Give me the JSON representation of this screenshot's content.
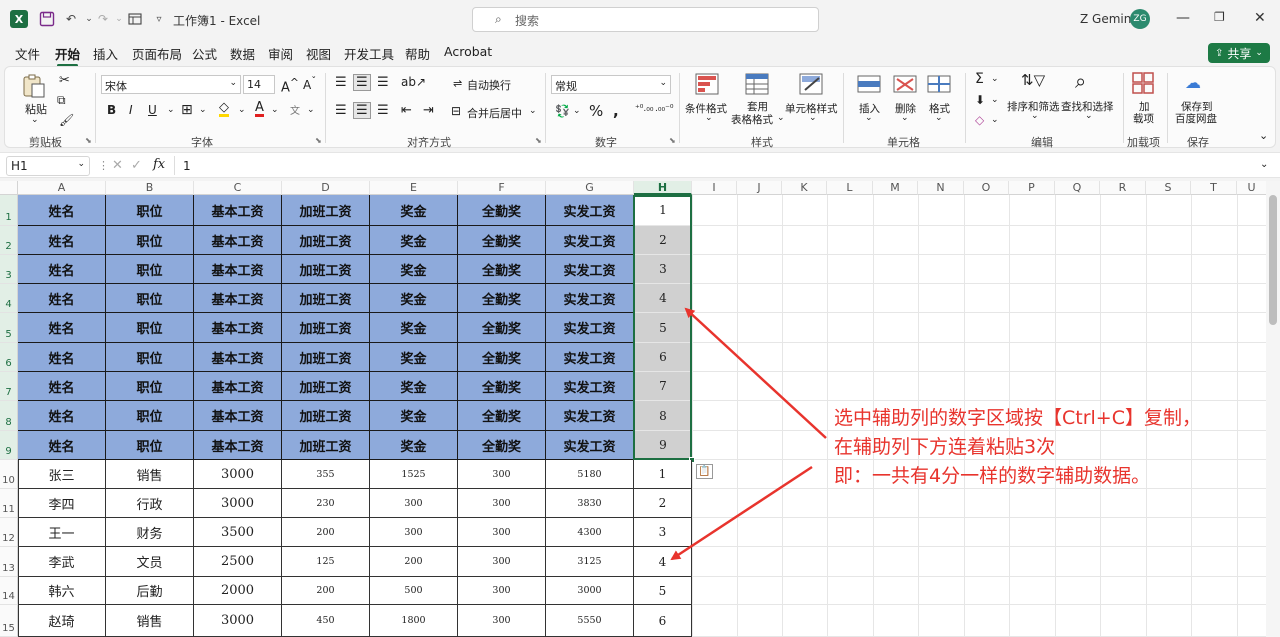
{
  "titlebar": {
    "title": "工作簿1 - Excel",
    "search_placeholder": "搜索",
    "user": "Z Gemini",
    "user_initials": "ZG"
  },
  "menu": [
    "文件",
    "开始",
    "插入",
    "页面布局",
    "公式",
    "数据",
    "审阅",
    "视图",
    "开发工具",
    "帮助",
    "Acrobat"
  ],
  "share": "共享",
  "ribbon": {
    "paste": "粘贴",
    "font_name": "宋体",
    "font_size": "14",
    "wrap_text": "自动换行",
    "merge_center": "合并后居中",
    "number_format": "常规",
    "cond_format": "条件格式",
    "table_format_1": "套用",
    "table_format_2": "表格格式",
    "cell_style": "单元格样式",
    "insert": "插入",
    "delete": "删除",
    "format": "格式",
    "sort_filter": "排序和筛选",
    "find_select": "查找和选择",
    "addin_1": "加",
    "addin_2": "载项",
    "baidu_1": "保存到",
    "baidu_2": "百度网盘",
    "groups": {
      "clipboard": "剪贴板",
      "font": "字体",
      "align": "对齐方式",
      "number": "数字",
      "styles": "样式",
      "cells": "单元格",
      "edit": "编辑",
      "addins": "加载项",
      "save": "保存"
    }
  },
  "formula": {
    "name_box": "H1",
    "fx": "fx",
    "value": "1"
  },
  "columns": [
    "A",
    "B",
    "C",
    "D",
    "E",
    "F",
    "G",
    "H",
    "I",
    "J",
    "K",
    "L",
    "M",
    "N",
    "O",
    "P",
    "Q",
    "R",
    "S",
    "T",
    "U"
  ],
  "rows": [
    "1",
    "2",
    "3",
    "4",
    "5",
    "6",
    "7",
    "8",
    "9",
    "10",
    "11",
    "12",
    "13",
    "14",
    "15"
  ],
  "header_row": [
    "姓名",
    "职位",
    "基本工资",
    "加班工资",
    "奖金",
    "全勤奖",
    "实发工资"
  ],
  "data_rows": [
    [
      "张三",
      "销售",
      "3000",
      "355",
      "1525",
      "300",
      "5180"
    ],
    [
      "李四",
      "行政",
      "3000",
      "230",
      "300",
      "300",
      "3830"
    ],
    [
      "王一",
      "财务",
      "3500",
      "200",
      "300",
      "300",
      "4300"
    ],
    [
      "李武",
      "文员",
      "2500",
      "125",
      "200",
      "300",
      "3125"
    ],
    [
      "韩六",
      "后勤",
      "2000",
      "200",
      "500",
      "300",
      "3000"
    ],
    [
      "赵琦",
      "销售",
      "3000",
      "450",
      "1800",
      "300",
      "5550"
    ]
  ],
  "h_top": [
    "1",
    "2",
    "3",
    "4",
    "5",
    "6",
    "7",
    "8",
    "9"
  ],
  "h_bottom": [
    "1",
    "2",
    "3",
    "4",
    "5",
    "6"
  ],
  "annotation": [
    "选中辅助列的数字区域按【Ctrl+C】复制，",
    "在辅助列下方连着粘贴3次",
    "即：一共有4分一样的数字辅助数据。"
  ],
  "colors": {
    "header_fill": "#8EAADB",
    "accent": "#1D6F42",
    "annotation": "#E8342D",
    "arrow": "#E8342D"
  }
}
